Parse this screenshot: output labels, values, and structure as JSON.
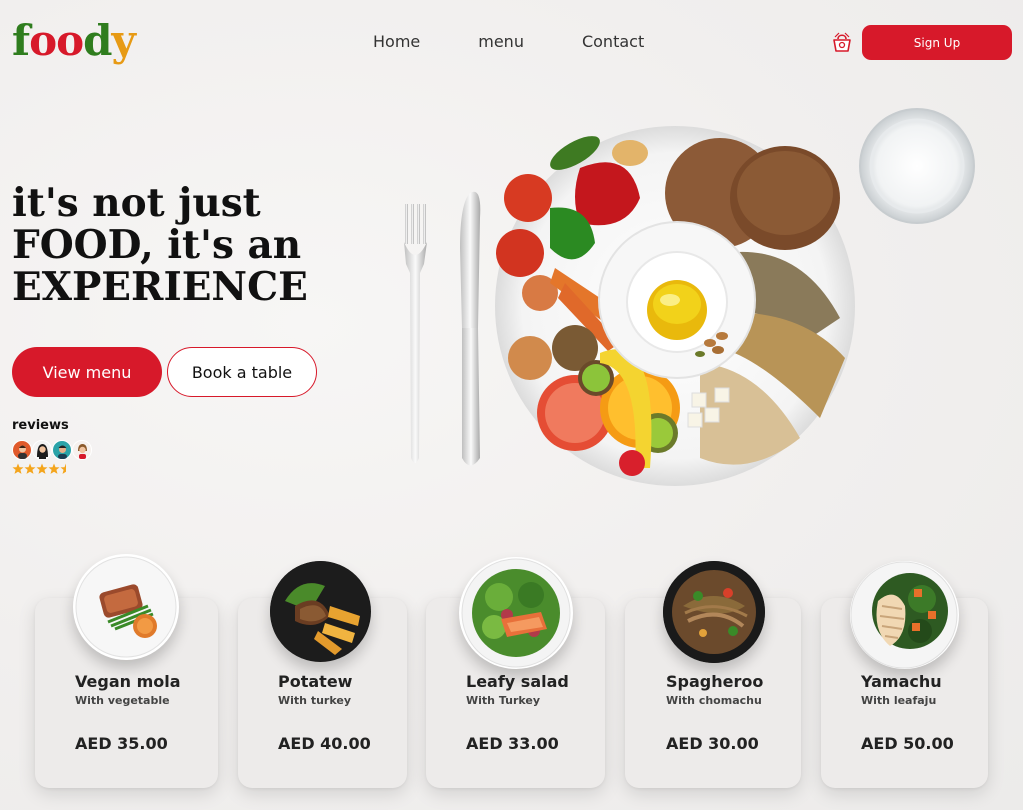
{
  "header": {
    "logo": [
      "f",
      "o",
      "o",
      "d",
      "y"
    ],
    "nav": [
      "Home",
      "menu",
      "Contact"
    ],
    "cart_icon": "shopping-basket-icon",
    "signup_label": "Sign Up"
  },
  "hero": {
    "title_lines": [
      "it's not just",
      "FOOD, it's an",
      "EXPERIENCE"
    ],
    "view_menu_label": "View menu",
    "book_table_label": "Book a table",
    "reviews_label": "reviews",
    "rating": 4.5,
    "rating_max": 5
  },
  "colors": {
    "accent": "#d7192a",
    "logo_green": "#2f7d1e",
    "logo_yellow": "#e79a14",
    "star": "#f4a51c"
  },
  "cards": [
    {
      "name": "Vegan mola",
      "sub": "With vegetable",
      "price": "AED 35.00"
    },
    {
      "name": "Potatew",
      "sub": "With turkey",
      "price": "AED 40.00"
    },
    {
      "name": "Leafy salad",
      "sub": "With Turkey",
      "price": "AED 33.00"
    },
    {
      "name": "Spagheroo",
      "sub": "With chomachu",
      "price": "AED 30.00"
    },
    {
      "name": "Yamachu",
      "sub": "With leafaju",
      "price": "AED 50.00"
    }
  ]
}
